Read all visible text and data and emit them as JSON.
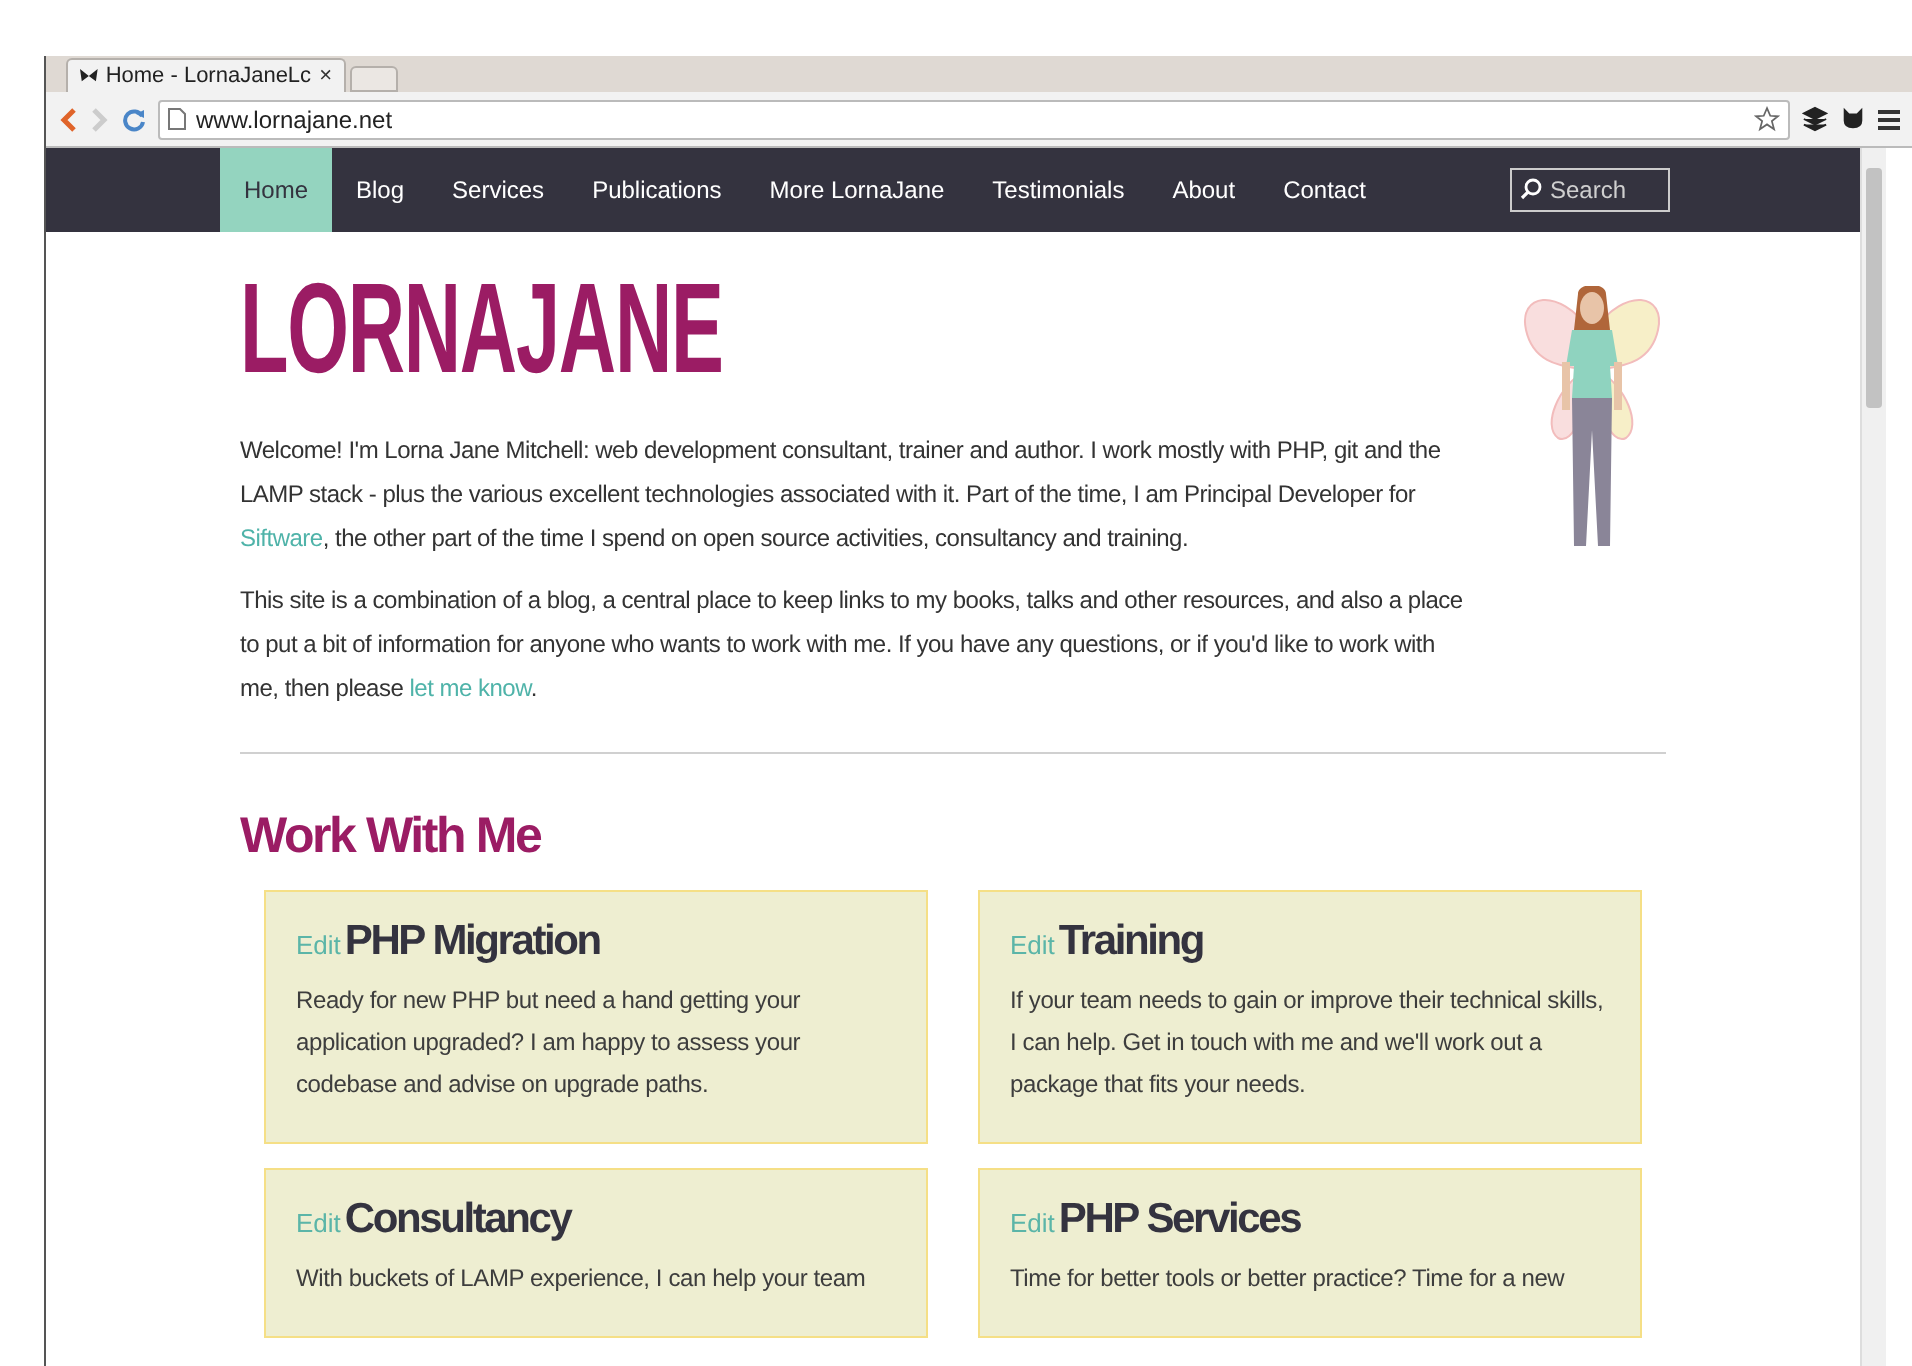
{
  "browser": {
    "tab_title": "Home - LornaJaneLc",
    "tab_close": "×",
    "url": "www.lornajane.net"
  },
  "nav": {
    "items": [
      {
        "label": "Home",
        "selected": true
      },
      {
        "label": "Blog",
        "selected": false
      },
      {
        "label": "Services",
        "selected": false
      },
      {
        "label": "Publications",
        "selected": false
      },
      {
        "label": "More LornaJane",
        "selected": false
      },
      {
        "label": "Testimonials",
        "selected": false
      },
      {
        "label": "About",
        "selected": false
      },
      {
        "label": "Contact",
        "selected": false
      }
    ],
    "search": {
      "placeholder": "Search"
    }
  },
  "site_title": "LORNAJANE",
  "intro": [
    {
      "before": "Welcome! I'm Lorna Jane Mitchell: web development consultant, trainer and author. I work mostly with PHP, git and the LAMP stack - plus the various excellent technologies associated with it. Part of the time, I am Principal Developer for ",
      "link": "Siftware",
      "after": ", the other part of the time I spend on open source activities, consultancy and training."
    },
    {
      "before": "This site is a combination of a blog, a central place to keep links to my books, talks and other resources, and also a place to put a bit of information for anyone who wants to work with me. If you have any questions, or if you'd like to work with me, then please ",
      "link": "let me know",
      "after": "."
    }
  ],
  "section_title": "Work With Me",
  "cards": [
    {
      "edit": "Edit",
      "title": "PHP Migration",
      "body": "Ready for new PHP but need a hand getting your application upgraded? I am happy to assess your codebase and advise on upgrade paths."
    },
    {
      "edit": "Edit",
      "title": "Training",
      "body": "If your team needs to gain or improve their technical skills, I can help. Get in touch with me and we'll work out a package that fits your needs."
    },
    {
      "edit": "Edit",
      "title": "Consultancy",
      "body": "With buckets of LAMP experience, I can help your team"
    },
    {
      "edit": "Edit",
      "title": "PHP Services",
      "body": "Time for better tools or better practice? Time for a new"
    }
  ]
}
